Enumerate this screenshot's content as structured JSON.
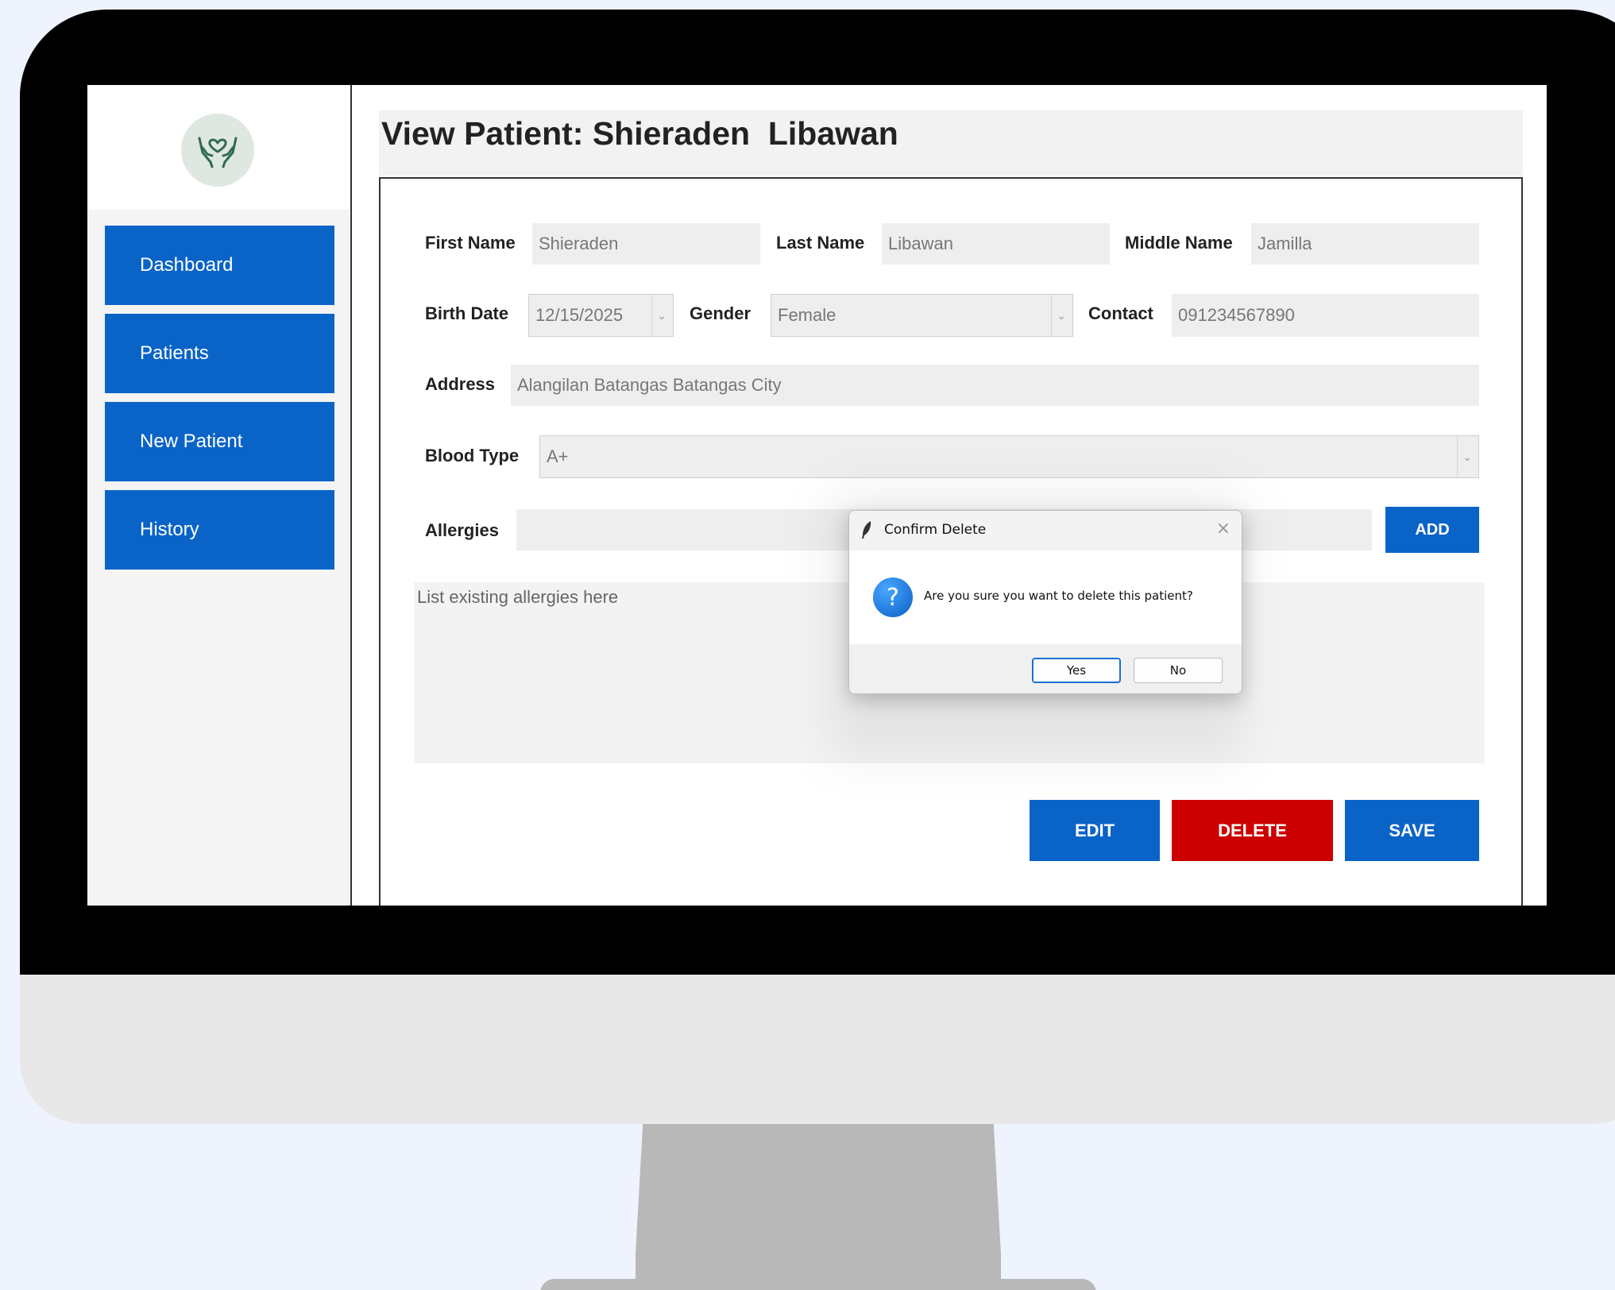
{
  "sidebar": {
    "items": [
      {
        "label": "Dashboard"
      },
      {
        "label": "Patients"
      },
      {
        "label": "New Patient"
      },
      {
        "label": "History"
      }
    ]
  },
  "header": {
    "title": "View Patient: Shieraden  Libawan"
  },
  "form": {
    "first_name": {
      "label": "First Name",
      "value": "Shieraden"
    },
    "last_name": {
      "label": "Last Name",
      "value": "Libawan"
    },
    "middle_name": {
      "label": "Middle Name",
      "value": "Jamilla"
    },
    "birth_date": {
      "label": "Birth Date",
      "value": "12/15/2025"
    },
    "gender": {
      "label": "Gender",
      "value": "Female"
    },
    "contact": {
      "label": "Contact",
      "value": "091234567890"
    },
    "address": {
      "label": "Address",
      "value": "Alangilan Batangas Batangas City"
    },
    "blood_type": {
      "label": "Blood Type",
      "value": "A+"
    },
    "allergies": {
      "label": "Allergies",
      "add_label": "ADD",
      "placeholder": "List existing allergies here"
    }
  },
  "actions": {
    "edit": "EDIT",
    "delete": "DELETE",
    "save": "SAVE"
  },
  "dialog": {
    "title": "Confirm Delete",
    "message": "Are you sure you want to delete this patient?",
    "yes": "Yes",
    "no": "No"
  },
  "colors": {
    "primary": "#0a64c8",
    "danger": "#cc0000"
  }
}
